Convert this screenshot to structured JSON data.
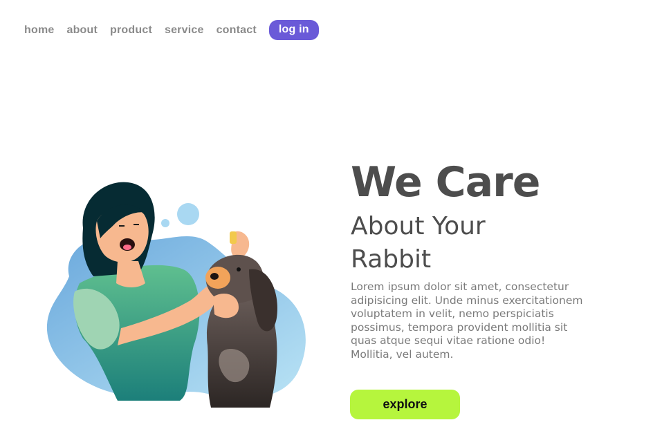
{
  "nav": {
    "items": [
      "home",
      "about",
      "product",
      "service",
      "contact"
    ],
    "login_label": "log in"
  },
  "hero": {
    "title": "We Care",
    "subtitle_line1": "About Your",
    "subtitle_line2": "Rabbit",
    "body": "Lorem ipsum dolor sit amet, consectetur adipisicing elit. Unde minus exercitationem voluptatem in velit, nemo perspiciatis possimus, tempora provident mollitia sit quas atque sequi vitae ratione odio! Mollitia, vel autem.",
    "cta_label": "explore"
  },
  "colors": {
    "accent": "#6a5ad8",
    "cta": "#b6f53d",
    "heading": "#4d4d4d",
    "text": "#7a7a7a"
  },
  "illustration": {
    "name": "woman-with-dog-illustration"
  }
}
